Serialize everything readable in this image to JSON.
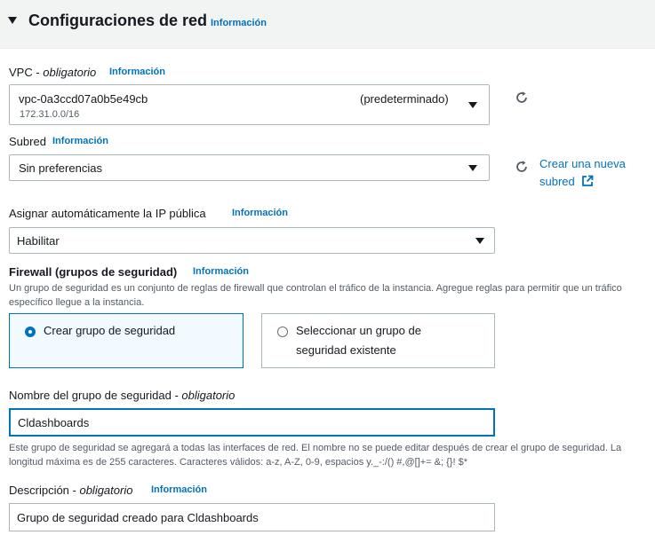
{
  "section": {
    "title": "Configuraciones de red",
    "info": "Información"
  },
  "vpc": {
    "label": "VPC - ",
    "required": "obligatorio",
    "info": "Información",
    "value": "vpc-0a3ccd07a0b5e49cb",
    "tag": "(predeterminado)",
    "cidr": "172.31.0.0/16"
  },
  "subnet": {
    "label": "Subred",
    "info": "Información",
    "value": "Sin preferencias",
    "create_link_line1": "Crear una nueva",
    "create_link_line2": "subred"
  },
  "public_ip": {
    "label": "Asignar automáticamente la IP pública",
    "info": "Información",
    "value": "Habilitar"
  },
  "firewall": {
    "label": "Firewall (grupos de seguridad)",
    "info": "Información",
    "description": "Un grupo de seguridad es un conjunto de reglas de firewall que controlan el tráfico de la instancia. Agregue reglas para permitir que un tráfico específico llegue a la instancia.",
    "options": [
      {
        "label": "Crear grupo de seguridad",
        "selected": true
      },
      {
        "label_line1": "Seleccionar un grupo de",
        "label_line2": "seguridad existente",
        "selected": false
      }
    ]
  },
  "sg_name": {
    "label": "Nombre del grupo de seguridad - ",
    "required": "obligatorio",
    "value": "Cldashboards",
    "hint": "Este grupo de seguridad se agregará a todas las interfaces de red. El nombre no se puede editar después de crear el grupo de seguridad. La longitud máxima es de 255 caracteres. Caracteres válidos: a-z, A-Z, 0-9, espacios y._-:/() #,@[]+= &; {}! $*"
  },
  "sg_description": {
    "label": "Descripción - ",
    "required": "obligatorio",
    "info": "Información",
    "value": "Grupo de seguridad creado para Cldashboards"
  },
  "colors": {
    "accent": "#0073bb",
    "text": "#16191f",
    "muted": "#545b64",
    "border": "#aab7b8"
  }
}
